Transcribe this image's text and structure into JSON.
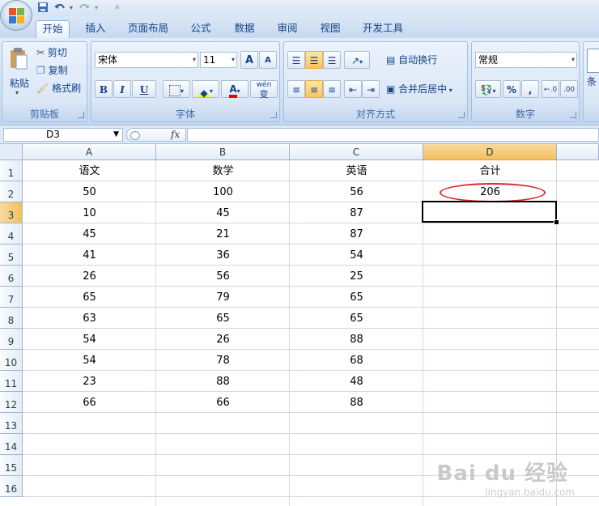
{
  "quick_access": {
    "save_icon": "save-icon",
    "undo_icon": "undo-icon",
    "redo_icon": "redo-icon"
  },
  "tabs": [
    {
      "label": "开始",
      "active": true
    },
    {
      "label": "插入"
    },
    {
      "label": "页面布局"
    },
    {
      "label": "公式"
    },
    {
      "label": "数据"
    },
    {
      "label": "审阅"
    },
    {
      "label": "视图"
    },
    {
      "label": "开发工具"
    }
  ],
  "ribbon": {
    "clipboard": {
      "group": "剪贴板",
      "paste": "粘贴",
      "cut": "剪切",
      "copy": "复制",
      "format_painter": "格式刷"
    },
    "font": {
      "group": "字体",
      "font_name": "宋体",
      "font_size": "11",
      "bold": "B",
      "italic": "I",
      "underline": "U",
      "wen": "wén",
      "bian": "变",
      "grow": "A",
      "shrink": "A"
    },
    "alignment": {
      "group": "对齐方式",
      "wrap": "自动换行",
      "merge": "合并后居中"
    },
    "number": {
      "group": "数字",
      "format": "常规",
      "percent": "%",
      "comma": ","
    },
    "styles": {
      "cond_label": "条"
    }
  },
  "formula_bar": {
    "name_box": "D3",
    "fx": "fx",
    "formula": ""
  },
  "columns": [
    "A",
    "B",
    "C",
    "D"
  ],
  "rows": [
    "1",
    "2",
    "3",
    "4",
    "5",
    "6",
    "7",
    "8",
    "9",
    "10",
    "11",
    "12",
    "13",
    "14",
    "15",
    "16"
  ],
  "sheet": {
    "headers": [
      "语文",
      "数学",
      "英语",
      "合计"
    ],
    "data": [
      [
        "50",
        "100",
        "56",
        "206"
      ],
      [
        "10",
        "45",
        "87",
        ""
      ],
      [
        "45",
        "21",
        "87",
        ""
      ],
      [
        "41",
        "36",
        "54",
        ""
      ],
      [
        "26",
        "56",
        "25",
        ""
      ],
      [
        "65",
        "79",
        "65",
        ""
      ],
      [
        "63",
        "65",
        "65",
        ""
      ],
      [
        "54",
        "26",
        "88",
        ""
      ],
      [
        "54",
        "78",
        "68",
        ""
      ],
      [
        "23",
        "88",
        "48",
        ""
      ],
      [
        "66",
        "66",
        "88",
        ""
      ]
    ]
  },
  "colors": {
    "accent": "#f1c15f",
    "annotation": "#e0262b"
  },
  "watermark": {
    "brand": "Bai du 经验",
    "url": "jingyan.baidu.com"
  }
}
